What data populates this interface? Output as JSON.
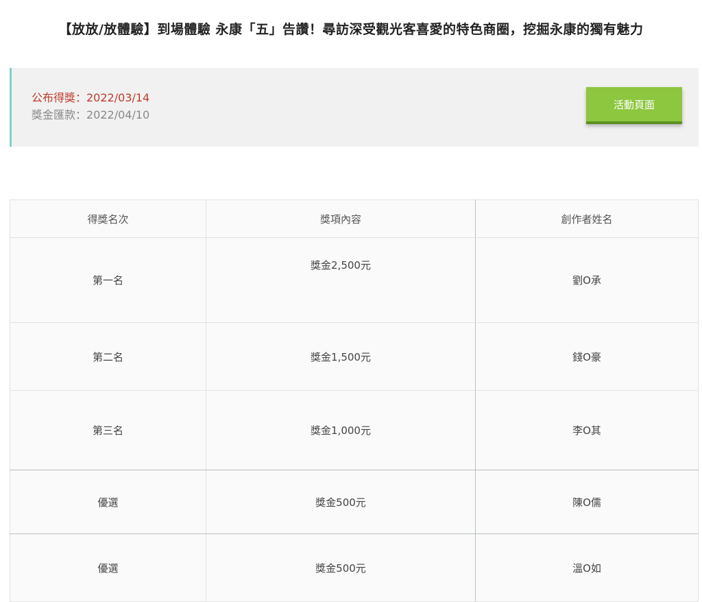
{
  "page": {
    "title": "【放放/放體驗】到場體驗 永康「五」告讚！尋訪深受觀光客喜愛的特色商圈，挖掘永康的獨有魅力"
  },
  "info": {
    "announce": "公布得獎：2022/03/14",
    "payout": "獎金匯款：2022/04/10",
    "button_label": "活動頁面",
    "colors": {
      "announce": "#c0392b",
      "button": "#8dc63f",
      "accent_border": "#7fcfd0"
    }
  },
  "table": {
    "headers": [
      "得獎名次",
      "獎項內容",
      "創作者姓名"
    ],
    "rows": [
      {
        "rank": "第一名",
        "prize": "獎金2,500元",
        "name": "劉O承"
      },
      {
        "rank": "第二名",
        "prize": "獎金1,500元",
        "name": "錢O豪"
      },
      {
        "rank": "第三名",
        "prize": "獎金1,000元",
        "name": "李O其"
      },
      {
        "rank": "優選",
        "prize": "獎金500元",
        "name": "陳O儒"
      },
      {
        "rank": "優選",
        "prize": "獎金500元",
        "name": "溫O如"
      }
    ]
  }
}
